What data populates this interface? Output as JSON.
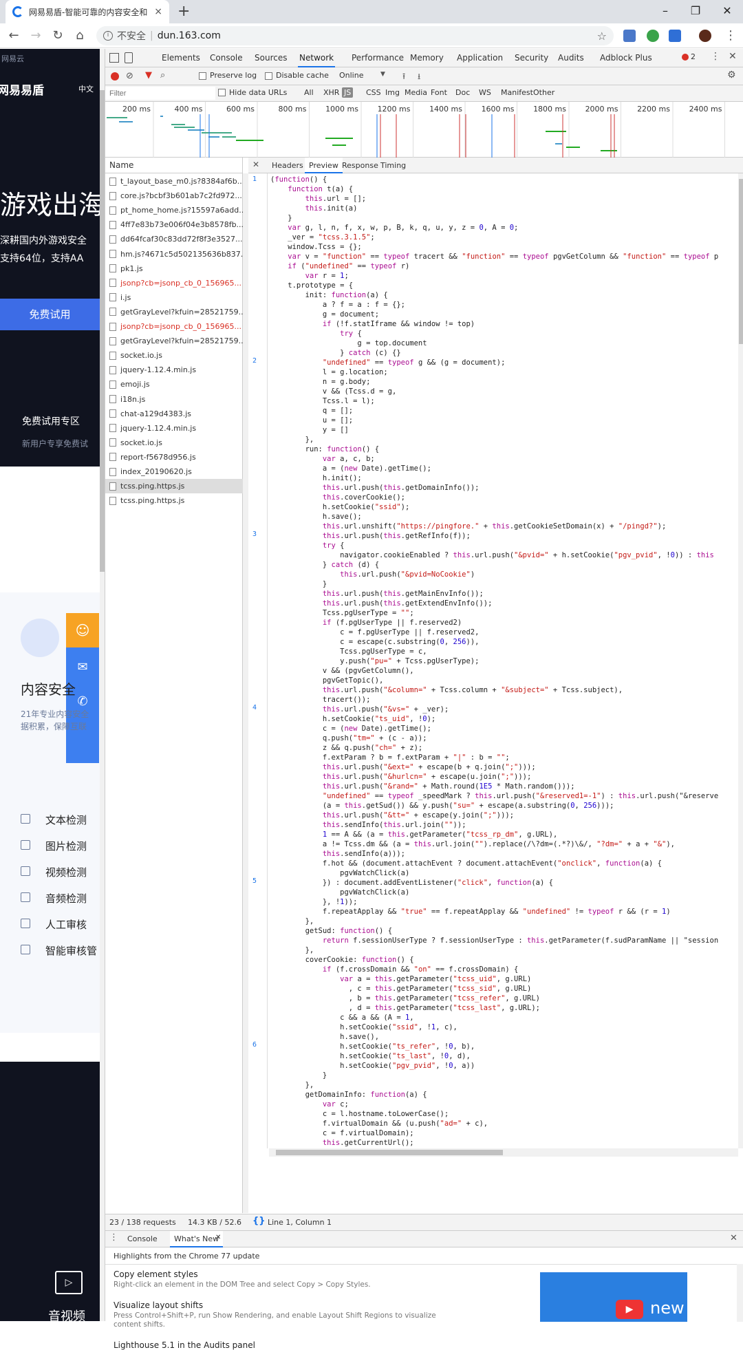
{
  "browser": {
    "tab_title": "网易易盾-智能可靠的内容安全和",
    "tab_close": "×",
    "new_tab": "+",
    "win_minimize": "–",
    "win_restore": "❐",
    "win_close": "✕",
    "insecure_label": "不安全",
    "separator": "|",
    "url": "dun.163.com"
  },
  "page": {
    "top_label": "网易云",
    "logo_text": "网易易盾",
    "lang": "中文",
    "hero_title": "游戏出海",
    "hero_sub1": "深耕国内外游戏安全",
    "hero_sub2": "支持64位，支持AA",
    "trial_button": "免费试用",
    "trial_zone_title": "免费试用专区",
    "trial_zone_sub": "新用户专享免费试",
    "section_title": "内容安全",
    "section_desc1": "21年专业内容安全",
    "section_desc2": "据积累，保障互联",
    "products": [
      "文本检测",
      "图片检测",
      "视频检测",
      "音频检测",
      "人工审核",
      "智能审核管"
    ],
    "bottom_label": "音视频"
  },
  "devtools": {
    "tabs": [
      "Elements",
      "Console",
      "Sources",
      "Network",
      "Performance",
      "Memory",
      "Application",
      "Security",
      "Audits",
      "Adblock Plus"
    ],
    "active_tab": "Network",
    "error_count": "2",
    "preserve_log": "Preserve log",
    "disable_cache": "Disable cache",
    "throttle": "Online",
    "filter_placeholder": "Filter",
    "hide_data_urls": "Hide data URLs",
    "filter_types": [
      "All",
      "XHR",
      "JS",
      "CSS",
      "Img",
      "Media",
      "Font",
      "Doc",
      "WS",
      "Manifest",
      "Other"
    ],
    "active_filter": "JS",
    "timeline_ticks": [
      "200 ms",
      "400 ms",
      "600 ms",
      "800 ms",
      "1000 ms",
      "1200 ms",
      "1400 ms",
      "1600 ms",
      "1800 ms",
      "2000 ms",
      "2200 ms",
      "2400 ms"
    ],
    "name_header": "Name",
    "requests": [
      {
        "name": "t_layout_base_m0.js?8384af6b...",
        "error": false
      },
      {
        "name": "core.js?bcbf3b601ab7c2fd972...",
        "error": false
      },
      {
        "name": "pt_home_home.js?15597a6add...",
        "error": false
      },
      {
        "name": "4ff7e83b73e006f04e3b8578fb...",
        "error": false
      },
      {
        "name": "dd64fcaf30c83dd72f8f3e3527...",
        "error": false
      },
      {
        "name": "hm.js?4671c5d502135636b837...",
        "error": false
      },
      {
        "name": "pk1.js",
        "error": false
      },
      {
        "name": "jsonp?cb=jsonp_cb_0_156965...",
        "error": true
      },
      {
        "name": "i.js",
        "error": false
      },
      {
        "name": "getGrayLevel?kfuin=28521759...",
        "error": false
      },
      {
        "name": "jsonp?cb=jsonp_cb_0_156965...",
        "error": true
      },
      {
        "name": "getGrayLevel?kfuin=28521759...",
        "error": false
      },
      {
        "name": "socket.io.js",
        "error": false
      },
      {
        "name": "jquery-1.12.4.min.js",
        "error": false
      },
      {
        "name": "emoji.js",
        "error": false
      },
      {
        "name": "i18n.js",
        "error": false
      },
      {
        "name": "chat-a129d4383.js",
        "error": false
      },
      {
        "name": "jquery-1.12.4.min.js",
        "error": false
      },
      {
        "name": "socket.io.js",
        "error": false
      },
      {
        "name": "report-f5678d956.js",
        "error": false
      },
      {
        "name": "index_20190620.js",
        "error": false
      },
      {
        "name": "tcss.ping.https.js",
        "error": false,
        "selected": true
      },
      {
        "name": "tcss.ping.https.js",
        "error": false
      }
    ],
    "preview_tabs": [
      "Headers",
      "Preview",
      "Response",
      "Timing"
    ],
    "active_preview": "Preview",
    "gutter_numbers": [
      "1",
      "2",
      "3",
      "4",
      "5",
      "6"
    ],
    "code_lines": [
      "(function() {",
      "    function t(a) {",
      "        this.url = [];",
      "        this.init(a)",
      "    }",
      "    var g, l, n, f, x, w, p, B, k, q, u, y, z = 0, A = 0;",
      "    _ver = \"tcss.3.1.5\";",
      "    window.Tcss = {};",
      "    var v = \"function\" == typeof tracert && \"function\" == typeof pgvGetColumn && \"function\" == typeof p",
      "    if (\"undefined\" == typeof r)",
      "        var r = 1;",
      "    t.prototype = {",
      "        init: function(a) {",
      "            a ? f = a : f = {};",
      "            g = document;",
      "            if (!f.statIframe && window != top)",
      "                try {",
      "                    g = top.document",
      "                } catch (c) {}",
      "            \"undefined\" == typeof g && (g = document);",
      "            l = g.location;",
      "            n = g.body;",
      "            v && (Tcss.d = g,",
      "            Tcss.l = l);",
      "            q = [];",
      "            u = [];",
      "            y = []",
      "        },",
      "        run: function() {",
      "            var a, c, b;",
      "            a = (new Date).getTime();",
      "            h.init();",
      "            this.url.push(this.getDomainInfo());",
      "            this.coverCookie();",
      "            h.setCookie(\"ssid\");",
      "            h.save();",
      "            this.url.unshift(\"https://pingfore.\" + this.getCookieSetDomain(x) + \"/pingd?\");",
      "            this.url.push(this.getRefInfo(f));",
      "            try {",
      "                navigator.cookieEnabled ? this.url.push(\"&pvid=\" + h.setCookie(\"pgv_pvid\", !0)) : this",
      "            } catch (d) {",
      "                this.url.push(\"&pvid=NoCookie\")",
      "            }",
      "            this.url.push(this.getMainEnvInfo());",
      "            this.url.push(this.getExtendEnvInfo());",
      "            Tcss.pgUserType = \"\";",
      "            if (f.pgUserType || f.reserved2)",
      "                c = f.pgUserType || f.reserved2,",
      "                c = escape(c.substring(0, 256)),",
      "                Tcss.pgUserType = c,",
      "                y.push(\"pu=\" + Tcss.pgUserType);",
      "            v && (pgvGetColumn(),",
      "            pgvGetTopic(),",
      "            this.url.push(\"&column=\" + Tcss.column + \"&subject=\" + Tcss.subject),",
      "            tracert());",
      "            this.url.push(\"&vs=\" + _ver);",
      "            h.setCookie(\"ts_uid\", !0);",
      "            c = (new Date).getTime();",
      "            q.push(\"tm=\" + (c - a));",
      "            z && q.push(\"ch=\" + z);",
      "            f.extParam ? b = f.extParam + \"|\" : b = \"\";",
      "            this.url.push(\"&ext=\" + escape(b + q.join(\";\")));",
      "            this.url.push(\"&hurlcn=\" + escape(u.join(\";\")));",
      "            this.url.push(\"&rand=\" + Math.round(1E5 * Math.random()));",
      "            \"undefined\" == typeof _speedMark ? this.url.push(\"&reserved1=-1\") : this.url.push(\"&reserve",
      "            (a = this.getSud()) && y.push(\"su=\" + escape(a.substring(0, 256)));",
      "            this.url.push(\"&tt=\" + escape(y.join(\";\")));",
      "            this.sendInfo(this.url.join(\"\"));",
      "            1 == A && (a = this.getParameter(\"tcss_rp_dm\", g.URL),",
      "            a != Tcss.dm && (a = this.url.join(\"\").replace(/\\?dm=(.*?)\\&/, \"?dm=\" + a + \"&\"),",
      "            this.sendInfo(a)));",
      "            f.hot && (document.attachEvent ? document.attachEvent(\"onclick\", function(a) {",
      "                pgvWatchClick(a)",
      "            }) : document.addEventListener(\"click\", function(a) {",
      "                pgvWatchClick(a)",
      "            }, !1));",
      "            f.repeatApplay && \"true\" == f.repeatApplay && \"undefined\" != typeof r && (r = 1)",
      "        },",
      "        getSud: function() {",
      "            return f.sessionUserType ? f.sessionUserType : this.getParameter(f.sudParamName || \"session",
      "        },",
      "        coverCookie: function() {",
      "            if (f.crossDomain && \"on\" == f.crossDomain) {",
      "                var a = this.getParameter(\"tcss_uid\", g.URL)",
      "                  , c = this.getParameter(\"tcss_sid\", g.URL)",
      "                  , b = this.getParameter(\"tcss_refer\", g.URL)",
      "                  , d = this.getParameter(\"tcss_last\", g.URL);",
      "                c && a && (A = 1,",
      "                h.setCookie(\"ssid\", !1, c),",
      "                h.save(),",
      "                h.setCookie(\"ts_refer\", !0, b),",
      "                h.setCookie(\"ts_last\", !0, d),",
      "                h.setCookie(\"pgv_pvid\", !0, a))",
      "            }",
      "        },",
      "        getDomainInfo: function(a) {",
      "            var c;",
      "            c = l.hostname.toLowerCase();",
      "            f.virtualDomain && (u.push(\"ad=\" + c),",
      "            c = f.virtualDomain);",
      "            this.getCurrentUrl();"
    ],
    "status_requests": "23 / 138 requests",
    "status_size": "14.3 KB / 52.6",
    "status_position": "Line 1, Column 1",
    "drawer_tabs": [
      "Console",
      "What's New"
    ],
    "drawer_active": "What's New",
    "whats_new_header": "Highlights from the Chrome 77 update",
    "news": [
      {
        "title": "Copy element styles",
        "desc": "Right-click an element in the DOM Tree and select Copy > Copy Styles."
      },
      {
        "title": "Visualize layout shifts",
        "desc": "Press Control+Shift+P, run Show Rendering, and enable Layout Shift Regions to visualize content shifts."
      },
      {
        "title": "Lighthouse 5.1 in the Audits panel",
        "desc": ""
      }
    ],
    "video_label": "new"
  }
}
